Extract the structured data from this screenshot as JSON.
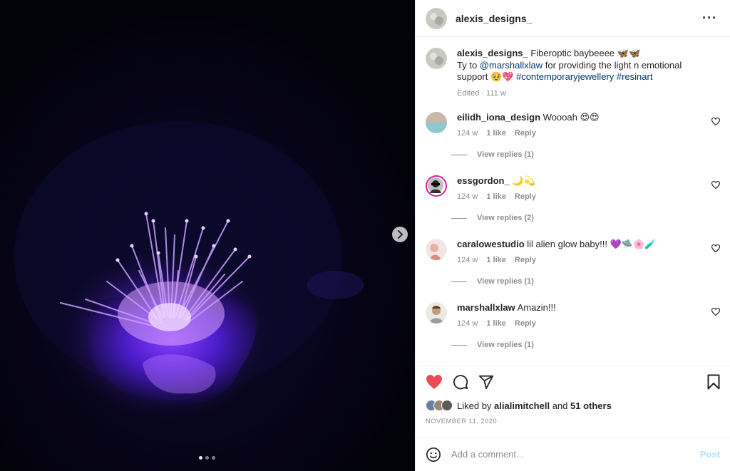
{
  "post": {
    "username": "alexis_designs_",
    "more_icon": "more-horizontal-icon"
  },
  "caption": {
    "username": "alexis_designs_",
    "text_1": "Fiberoptic baybeeee 🦋🦋",
    "text_2": "Ty to ",
    "mention": "@marshallxlaw",
    "text_3": " for providing the light n emotional support 🥹💖 ",
    "hashtag_1": "#contemporaryjewellery",
    "hashtag_2": "#resinart",
    "edited": "Edited",
    "separator": " · ",
    "age": "111 w"
  },
  "comments": [
    {
      "username": "eilidh_iona_design",
      "text": "Woooah 😍😍",
      "age": "124 w",
      "likes": "1 like",
      "reply": "Reply",
      "view_replies": "View replies (1)"
    },
    {
      "username": "essgordon_",
      "text": "🌙💫",
      "age": "124 w",
      "likes": "1 like",
      "reply": "Reply",
      "view_replies": "View replies (2)"
    },
    {
      "username": "caralowestudio",
      "text": "lil alien glow baby!!! 💜🛸🌸🧪",
      "age": "124 w",
      "likes": "1 like",
      "reply": "Reply",
      "view_replies": "View replies (1)"
    },
    {
      "username": "marshallxlaw",
      "text": "Amazin!!!",
      "age": "124 w",
      "likes": "1 like",
      "reply": "Reply",
      "view_replies": "View replies (1)"
    }
  ],
  "likes": {
    "prefix": "Liked by ",
    "user": "alialimitchell",
    "middle": " and ",
    "others": "51 others"
  },
  "date": "NOVEMBER 11, 2020",
  "add_comment": {
    "placeholder": "Add a comment...",
    "post_label": "Post"
  },
  "colors": {
    "heart": "#ed4956",
    "link": "#00376b",
    "muted": "#8e8e8e",
    "post_button": "#b2dffc",
    "glow": "#7b2cff"
  },
  "carousel": {
    "current": 1,
    "total": 3
  }
}
